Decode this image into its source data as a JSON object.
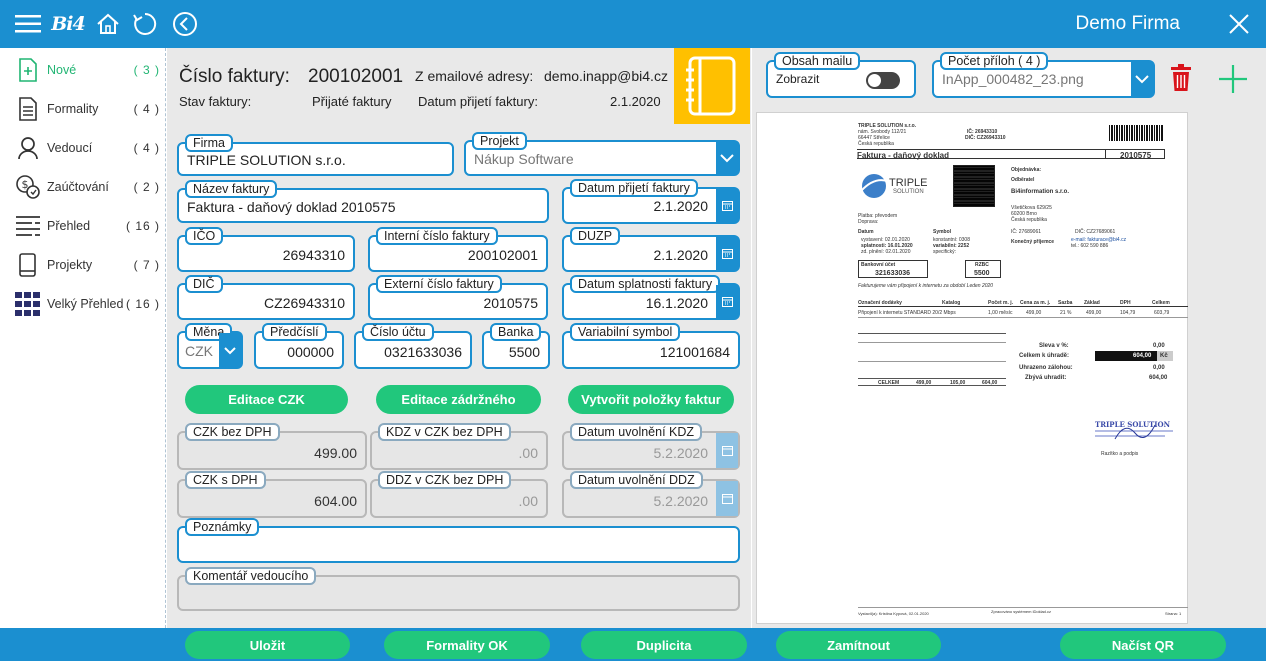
{
  "topbar": {
    "brand": "Bi4",
    "company": "Demo Firma"
  },
  "sidebar": {
    "items": [
      {
        "label": "Nové",
        "count": "( 3 )"
      },
      {
        "label": "Formality",
        "count": "( 4 )"
      },
      {
        "label": "Vedoucí",
        "count": "( 4 )"
      },
      {
        "label": "Zaúčtování",
        "count": "( 2 )"
      },
      {
        "label": "Přehled",
        "count": "( 16 )"
      },
      {
        "label": "Projekty",
        "count": "( 7 )"
      },
      {
        "label": "Velký Přehled",
        "count": "( 16 )"
      }
    ]
  },
  "header": {
    "invoice_number_label": "Číslo faktury:",
    "invoice_number": "200102001",
    "email_label": "Z emailové adresy:",
    "email": "demo.inapp@bi4.cz",
    "status_label": "Stav faktury:",
    "status": "Přijaté faktury",
    "received_label": "Datum přijetí faktury:",
    "received": "2.1.2020"
  },
  "form": {
    "firma": {
      "label": "Firma",
      "value": "TRIPLE SOLUTION s.r.o."
    },
    "projekt": {
      "label": "Projekt",
      "value": "Nákup Software"
    },
    "nazev": {
      "label": "Název faktury",
      "value": "Faktura - daňový doklad 2010575"
    },
    "datum_prijeti": {
      "label": "Datum přijetí faktury",
      "value": "2.1.2020"
    },
    "ico": {
      "label": "IČO",
      "value": "26943310"
    },
    "interni": {
      "label": "Interní číslo faktury",
      "value": "200102001"
    },
    "duzp": {
      "label": "DUZP",
      "value": "2.1.2020"
    },
    "dic": {
      "label": "DIČ",
      "value": "CZ26943310"
    },
    "externi": {
      "label": "Externí číslo faktury",
      "value": "2010575"
    },
    "splatnost": {
      "label": "Datum splatnosti faktury",
      "value": "16.1.2020"
    },
    "mena": {
      "label": "Měna",
      "value": "CZK"
    },
    "predcisli": {
      "label": "Předčíslí",
      "value": "000000"
    },
    "cislo_uctu": {
      "label": "Číslo účtu",
      "value": "0321633036"
    },
    "banka": {
      "label": "Banka",
      "value": "5500"
    },
    "vs": {
      "label": "Variabilní symbol",
      "value": "121001684"
    },
    "czk_bez_dph": {
      "label": "CZK bez DPH",
      "value": "499.00"
    },
    "kdz": {
      "label": "KDZ v CZK bez DPH",
      "value": ".00"
    },
    "uvolneni_kdz": {
      "label": "Datum uvolnění KDZ",
      "value": "5.2.2020"
    },
    "czk_s_dph": {
      "label": "CZK s DPH",
      "value": "604.00"
    },
    "ddz": {
      "label": "DDZ v CZK bez DPH",
      "value": ".00"
    },
    "uvolneni_ddz": {
      "label": "Datum uvolnění DDZ",
      "value": "5.2.2020"
    },
    "poznamky": {
      "label": "Poznámky",
      "value": ""
    },
    "komentar": {
      "label": "Komentář vedoucího",
      "value": ""
    }
  },
  "actions": {
    "editace_czk": "Editace CZK",
    "editace_zadrzneho": "Editace zádržného",
    "vytvorit_polozky": "Vytvořit položky faktur"
  },
  "mail": {
    "obsah_label": "Obsah mailu",
    "zobrazit": "Zobrazit",
    "pocet_label": "Počet příloh  ( 4 )",
    "attachment": "InApp_000482_23.png"
  },
  "preview": {
    "company": "TRIPLE SOLUTION s.r.o.",
    "address1": "nám. Svobody 112/21",
    "address2": "66447  Střelice",
    "country": "Česká republika",
    "ic": "IČ: 26943310",
    "dic": "DIČ: CZ26943310",
    "doc_title": "Faktura - daňový doklad",
    "doc_number": "2010575",
    "logo_text": "TRIPLE",
    "logo_sub": "SOLUTION",
    "objednavka": "Objednávka:",
    "odberatel": "Odběratel",
    "customer": "Bi4information s.r.o.",
    "cust_addr1": "Všetičkova 629/25",
    "cust_addr2": "60200  Brno",
    "cust_country": "Česká republika",
    "platba": "Platba:   převodem",
    "doprava": "Doprava:",
    "datum": "Datum",
    "symbol": "Symbol",
    "vystaveni": "vystavení:  02.01.2020",
    "splatnost": "splatnosti:  16.01.2020",
    "plneni": "zd. plnění:  02.01.2020",
    "konstantni": "konstantní:  0308",
    "variabilni": "variabilní:  2252",
    "specificky": "specifický:",
    "cust_ic": "IČ: 27689061",
    "cust_dic": "DIČ: CZ27689061",
    "prijemce": "Konečný příjemce",
    "email": "e-mail:  fakturace@bi4.cz",
    "tel": "tel.:  602 590 886",
    "bank_label": "Bankovní účet",
    "bank_value": "321633036",
    "rzbc_label": "RZBC",
    "rzbc_value": "5500",
    "note": "Fakturujeme vám připojení k internetu za období Leden 2020",
    "col_item": "Označení dodávky",
    "col_katalog": "Katalog",
    "col_pocet": "Počet  m. j.",
    "col_cena": "Cena za m. j.",
    "col_sazba": "Sazba",
    "col_zaklad": "Základ",
    "col_dph": "DPH",
    "col_celkem": "Celkem",
    "row_item": "Připojení k internetu STANDARD 20/2 Mbps",
    "row_pocet": "1,00  měsíc",
    "row_cena": "499,00",
    "row_sazba": "21  %",
    "row_zaklad": "499,00",
    "row_dph": "104,79",
    "row_celkem": "603,79",
    "sleva": "Sleva v %:",
    "sleva_val": "0,00",
    "celkem": "Celkem k úhradě:",
    "celkem_val": "604,00",
    "celkem_cur": "Kč",
    "uhrazeno": "Uhrazeno zálohou:",
    "uhrazeno_val": "0,00",
    "zbyva": "Zbývá uhradit:",
    "zbyva_val": "604,00",
    "sum_zaklad": "499,00",
    "sum_dph": "105,00",
    "sum_celkem": "604,00",
    "sum_label": "CELKEM",
    "razitko": "Razítko a podpis",
    "footer_left": "Vystavil(a):  Kristina Kypová, 02.01.2020",
    "footer_mid": "Zpracováno systémem iDoklad.cz",
    "footer_right": "Strana: 1"
  },
  "bottombar": {
    "ulozit": "Uložit",
    "formality_ok": "Formality OK",
    "duplicita": "Duplicita",
    "zamitnout": "Zamítnout",
    "nacist_qr": "Načíst QR"
  },
  "colors": {
    "accent": "#1b8fd0",
    "green": "#21c77c",
    "yellow": "#ffc000",
    "red": "#d9141b"
  }
}
